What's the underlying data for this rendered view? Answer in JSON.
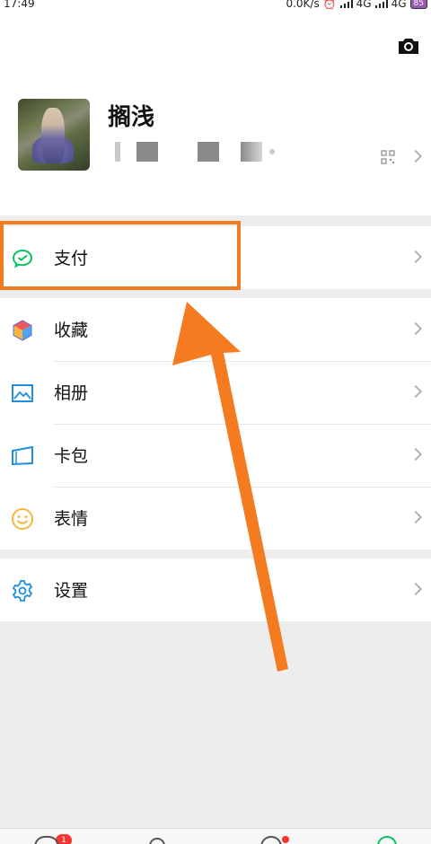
{
  "status_bar": {
    "time": "17:49",
    "net_speed": "0.0K/s",
    "network_1": "4G",
    "network_2": "4G",
    "battery": "85"
  },
  "profile": {
    "nickname": "搁浅"
  },
  "menu": {
    "pay": {
      "label": "支付"
    },
    "favorites": {
      "label": "收藏"
    },
    "album": {
      "label": "相册"
    },
    "cards": {
      "label": "卡包"
    },
    "stickers": {
      "label": "表情"
    },
    "settings": {
      "label": "设置"
    }
  },
  "tabbar": {
    "chats_badge": "1"
  },
  "colors": {
    "accent_orange": "#f47b20",
    "wechat_green": "#07c160",
    "background": "#ededed"
  },
  "icons": {
    "camera": "camera-icon",
    "qr_code": "qr-code-icon",
    "pay": "wechat-pay-icon",
    "favorites": "cube-icon",
    "album": "picture-icon",
    "cards": "card-icon",
    "stickers": "smiley-icon",
    "settings": "gear-icon"
  }
}
